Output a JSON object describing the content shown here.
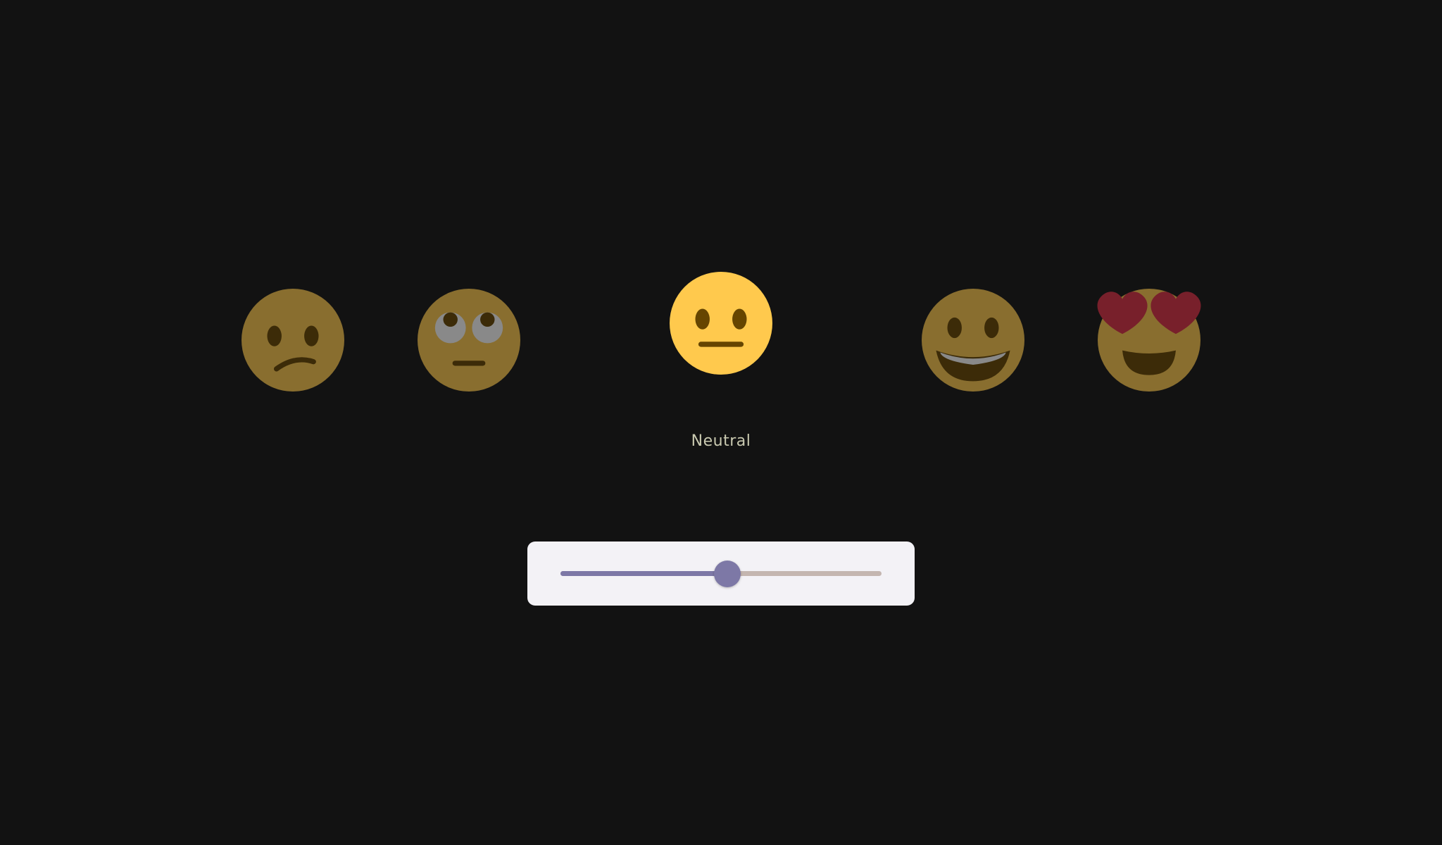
{
  "mood": {
    "selected_label": "Neutral",
    "options": [
      {
        "icon": "confused-face-icon"
      },
      {
        "icon": "face-with-rolling-eyes-icon"
      },
      {
        "icon": "neutral-face-icon"
      },
      {
        "icon": "grinning-face-icon"
      },
      {
        "icon": "heart-eyes-face-icon"
      }
    ],
    "selected_index": 2
  },
  "slider": {
    "value": 0.52
  },
  "colors": {
    "background": "#121212",
    "face": "#FFC94D",
    "feature": "#664500",
    "heart": "#DD2E44",
    "accent": "#7D78A6",
    "track": "#C4B6B0",
    "card": "#F3F2F6",
    "label": "#C9C9B0"
  }
}
